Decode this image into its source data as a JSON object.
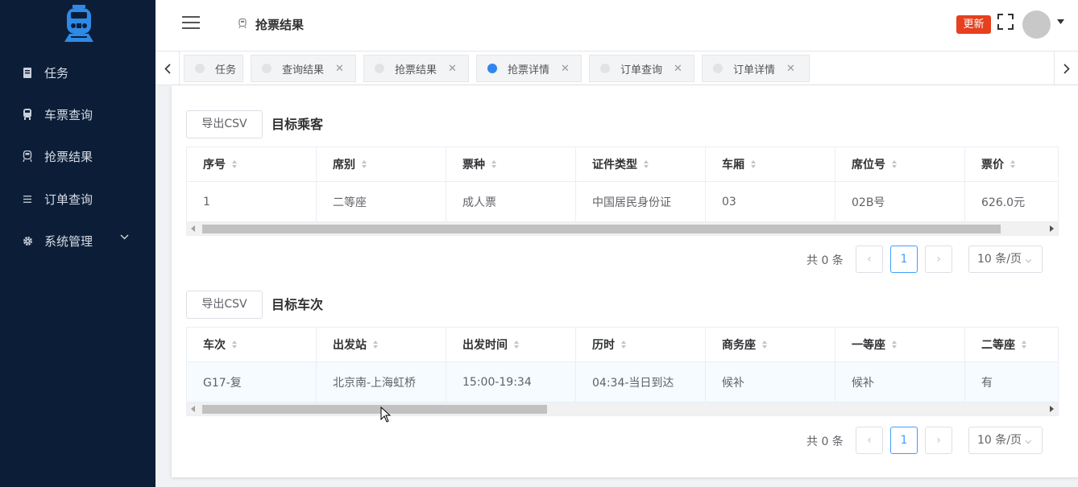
{
  "sidebar": {
    "items": [
      {
        "label": "任务",
        "icon": "document-icon"
      },
      {
        "label": "车票查询",
        "icon": "train-icon"
      },
      {
        "label": "抢票结果",
        "icon": "train-outline-icon"
      },
      {
        "label": "订单查询",
        "icon": "list-icon"
      },
      {
        "label": "系统管理",
        "icon": "gear-icon"
      }
    ]
  },
  "header": {
    "title": "抢票结果",
    "update_label": "更新"
  },
  "tabs": [
    {
      "label": "任务",
      "closable": false,
      "active": false
    },
    {
      "label": "查询结果",
      "closable": true,
      "active": false
    },
    {
      "label": "抢票结果",
      "closable": true,
      "active": false
    },
    {
      "label": "抢票详情",
      "closable": true,
      "active": true
    },
    {
      "label": "订单查询",
      "closable": true,
      "active": false
    },
    {
      "label": "订单详情",
      "closable": true,
      "active": false
    }
  ],
  "passengers": {
    "export_label": "导出CSV",
    "title": "目标乘客",
    "columns": [
      "序号",
      "席别",
      "票种",
      "证件类型",
      "车厢",
      "席位号",
      "票价"
    ],
    "rows": [
      [
        "1",
        "二等座",
        "成人票",
        "中国居民身份证",
        "03",
        "02B号",
        "626.0元"
      ]
    ],
    "scroll_thumb_fraction": 0.95,
    "pagination": {
      "total": "共 0 条",
      "page": "1",
      "page_size": "10 条/页"
    }
  },
  "trains": {
    "export_label": "导出CSV",
    "title": "目标车次",
    "columns": [
      "车次",
      "出发站",
      "出发时间",
      "历时",
      "商务座",
      "一等座",
      "二等座"
    ],
    "rows": [
      [
        "G17-复",
        "北京南-上海虹桥",
        "15:00-19:34",
        "04:34-当日到达",
        "候补",
        "候补",
        "有"
      ]
    ],
    "scroll_thumb_fraction": 0.41,
    "pagination": {
      "total": "共 0 条",
      "page": "1",
      "page_size": "10 条/页"
    }
  },
  "colors": {
    "sidebar_bg": "#0c1e37",
    "accent": "#409eff",
    "update_btn": "#e6401e",
    "active_tab_dot": "#2f86f0"
  }
}
